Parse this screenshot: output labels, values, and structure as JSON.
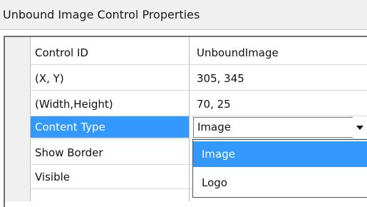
{
  "window": {
    "title": "Unbound Image Control Properties"
  },
  "properties": [
    {
      "name": "Control ID",
      "value": "UnboundImage"
    },
    {
      "name": "(X, Y)",
      "value": "305, 345"
    },
    {
      "name": "(Width,Height)",
      "value": "70, 25"
    },
    {
      "name": "Content Type",
      "value": "Image",
      "selected": true
    },
    {
      "name": "Show Border",
      "value": ""
    },
    {
      "name": "Visible",
      "value": ""
    }
  ],
  "content_type_dropdown": {
    "selected": "Image",
    "options": [
      "Image",
      "Logo"
    ]
  },
  "colors": {
    "selection": "#3399ff",
    "header_bg": "#f0f0f0"
  },
  "icons": {
    "dropdown": "chevron-down-icon"
  }
}
